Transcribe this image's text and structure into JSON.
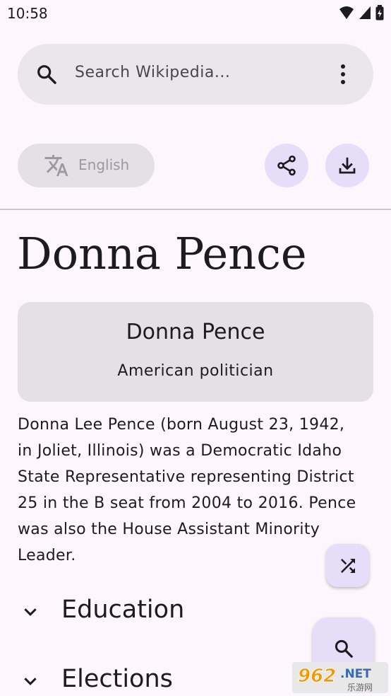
{
  "status_bar": {
    "time": "10:58"
  },
  "search": {
    "placeholder": "Search Wikipedia..."
  },
  "toolbar": {
    "language_label": "English"
  },
  "article": {
    "title": "Donna Pence",
    "infobox": {
      "title": "Donna Pence",
      "subtitle": "American politician"
    },
    "summary_lines": [
      "Donna Lee Pence (born August 23, 1942,",
      "in Joliet, Illinois) was a Democratic Idaho",
      "State Representative representing District",
      "25 in the B seat from 2004 to 2016. Pence",
      "was also the House Assistant Minority",
      "Leader."
    ],
    "sections": [
      {
        "label": "Education"
      },
      {
        "label": "Elections"
      }
    ]
  },
  "watermark": {
    "brand": "962",
    "suffix": ".NET",
    "caption": "乐游网"
  },
  "colors": {
    "accent_container": "#e6def8",
    "surface": "#fdf7fd",
    "search_bg": "#ebe6ec"
  },
  "icons": [
    "wifi-icon",
    "signal-icon",
    "battery-icon",
    "search-icon",
    "more-vert-icon",
    "translate-icon",
    "share-icon",
    "download-icon",
    "chevron-down-icon",
    "shuffle-icon"
  ]
}
